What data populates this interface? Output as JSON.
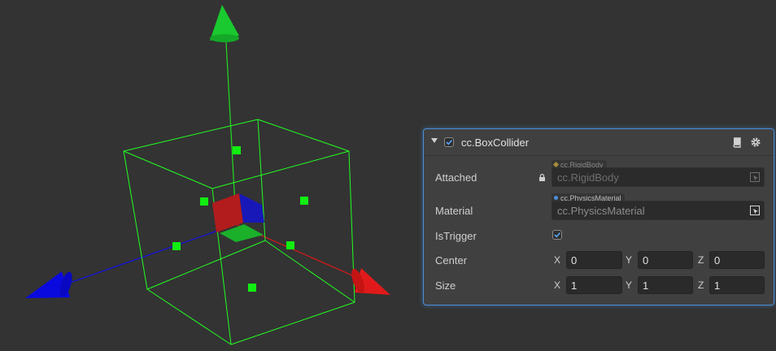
{
  "component": {
    "title": "cc.BoxCollider",
    "enabled": true,
    "icons": [
      "help-book-icon",
      "gear-icon"
    ]
  },
  "properties": {
    "attached": {
      "label": "Attached",
      "type_tag": "cc.RigidBody",
      "value": "cc.RigidBody",
      "locked": true,
      "tag_color": "#a68b3a"
    },
    "material": {
      "label": "Material",
      "type_tag": "cc.PhysicsMaterial",
      "value": "cc.PhysicsMaterial",
      "tag_color": "#4a8fd8"
    },
    "is_trigger": {
      "label": "IsTrigger",
      "checked": true
    },
    "center": {
      "label": "Center",
      "axes": [
        "X",
        "Y",
        "Z"
      ],
      "values": [
        "0",
        "0",
        "0"
      ]
    },
    "size": {
      "label": "Size",
      "axes": [
        "X",
        "Y",
        "Z"
      ],
      "values": [
        "1",
        "1",
        "1"
      ]
    }
  },
  "gizmo": {
    "wire_color": "#22ff22",
    "axis_colors": {
      "x": "#ff1a1a",
      "y": "#1acc33",
      "z": "#0a0aee"
    }
  }
}
